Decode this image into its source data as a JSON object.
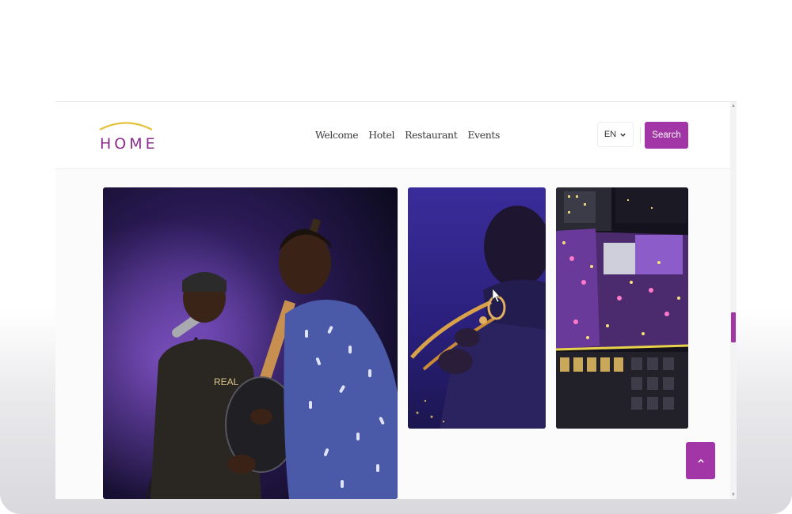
{
  "header": {
    "logo_text": "HOME",
    "nav": [
      {
        "label": "Welcome"
      },
      {
        "label": "Hotel"
      },
      {
        "label": "Restaurant"
      },
      {
        "label": "Events"
      }
    ],
    "language": "EN",
    "search_label": "Search"
  },
  "colors": {
    "brand": "#a336a6",
    "logo_arc": "#e5c23a"
  },
  "gallery": [
    {
      "subject": "guitar-band-photo",
      "shirt_text": "REAL"
    },
    {
      "subject": "trumpet-player-photo"
    },
    {
      "subject": "rooftop-aerial-photo"
    }
  ],
  "icons": {
    "lang_chevron": "chevron-down-icon",
    "back_to_top": "chevron-up-icon"
  }
}
